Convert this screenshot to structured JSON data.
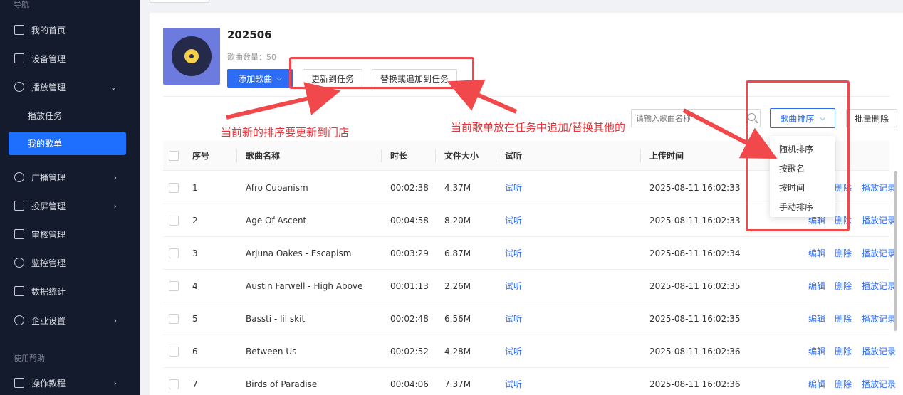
{
  "sidebar": {
    "section_nav": "导航",
    "section_help": "使用帮助",
    "items": [
      {
        "label": "我的首页"
      },
      {
        "label": "设备管理"
      },
      {
        "label": "播放管理"
      },
      {
        "label": "播放任务"
      },
      {
        "label": "我的歌单"
      },
      {
        "label": "广播管理"
      },
      {
        "label": "投屏管理"
      },
      {
        "label": "审核管理"
      },
      {
        "label": "监控管理"
      },
      {
        "label": "数据统计"
      },
      {
        "label": "企业设置"
      },
      {
        "label": "操作教程"
      }
    ]
  },
  "playlist": {
    "title": "202506",
    "count_text": "歌曲数量：50"
  },
  "toolbar": {
    "add_song": "添加歌曲",
    "update_task": "更新到任务",
    "replace_append": "替换或追加到任务",
    "search_placeholder": "请输入歌曲名称",
    "sort_label": "歌曲排序",
    "batch_delete": "批量删除"
  },
  "sort_menu": [
    "随机排序",
    "按歌名",
    "按时间",
    "手动排序"
  ],
  "table": {
    "headers": [
      "序号",
      "歌曲名称",
      "时长",
      "文件大小",
      "试听",
      "上传时间"
    ],
    "rows": [
      {
        "no": "1",
        "name": "Afro Cubanism",
        "duration": "00:02:38",
        "size": "4.37M",
        "listen": "试听",
        "time": "2025-08-11 16:02:33"
      },
      {
        "no": "2",
        "name": "Age Of Ascent",
        "duration": "00:04:58",
        "size": "8.20M",
        "listen": "试听",
        "time": "2025-08-11 16:02:33"
      },
      {
        "no": "3",
        "name": "Arjuna Oakes - Escapism",
        "duration": "00:03:29",
        "size": "6.87M",
        "listen": "试听",
        "time": "2025-08-11 16:02:34"
      },
      {
        "no": "4",
        "name": "Austin Farwell - High Above",
        "duration": "00:01:13",
        "size": "2.26M",
        "listen": "试听",
        "time": "2025-08-11 16:02:35"
      },
      {
        "no": "5",
        "name": "Bassti - lil skit",
        "duration": "00:02:48",
        "size": "6.56M",
        "listen": "试听",
        "time": "2025-08-11 16:02:35"
      },
      {
        "no": "6",
        "name": "Between Us",
        "duration": "00:02:52",
        "size": "4.28M",
        "listen": "试听",
        "time": "2025-08-11 16:02:36"
      },
      {
        "no": "7",
        "name": "Birds of Paradise",
        "duration": "00:04:06",
        "size": "7.37M",
        "listen": "试听",
        "time": "2025-08-11 16:02:36"
      }
    ],
    "actions": {
      "edit": "编辑",
      "delete": "删除",
      "history": "播放记录"
    }
  },
  "annotations": {
    "left": "当前新的排序要更新到门店",
    "right": "当前歌单放在任务中追加/替换其他的",
    "color": "#e8343a"
  }
}
